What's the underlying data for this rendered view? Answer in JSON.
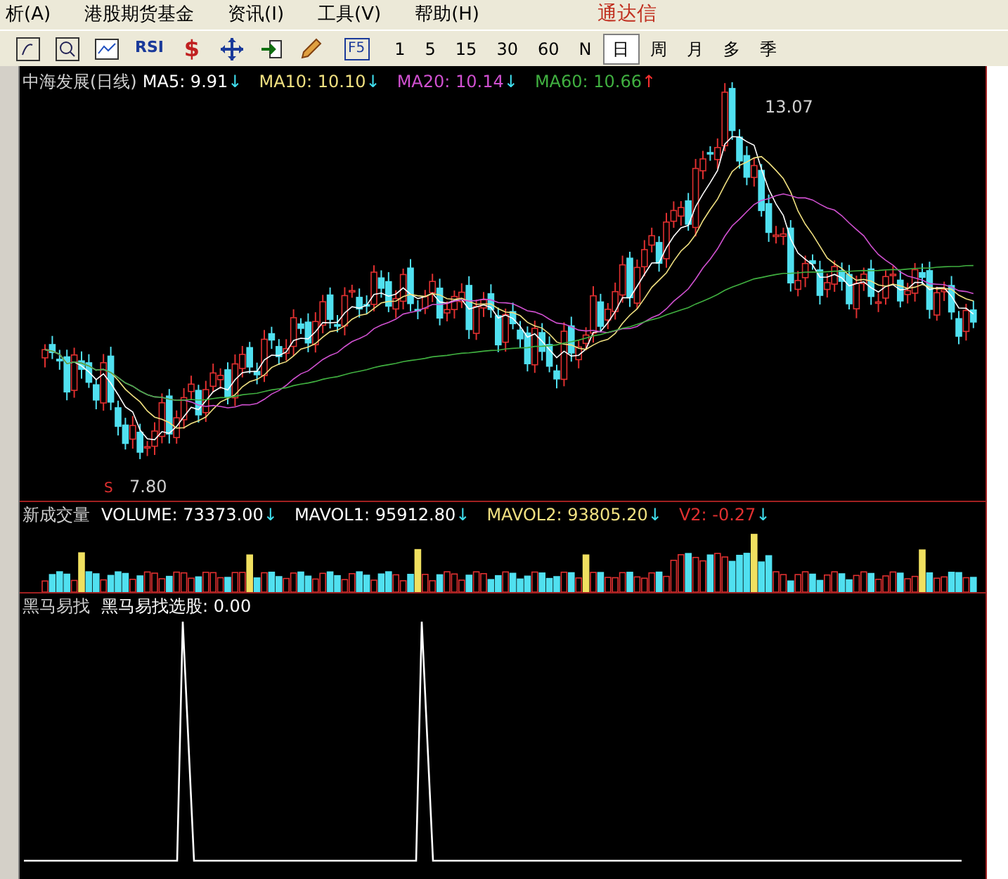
{
  "menu": [
    {
      "label": "析(A)"
    },
    {
      "label": "港股期货基金"
    },
    {
      "label": "资讯(I)"
    },
    {
      "label": "工具(V)"
    },
    {
      "label": "帮助(H)"
    }
  ],
  "brand": "通达信",
  "toolbar": {
    "rsi": "RSI",
    "dollar": "$",
    "f5": "F5",
    "periods": [
      {
        "label": "1",
        "selected": false
      },
      {
        "label": "5",
        "selected": false
      },
      {
        "label": "15",
        "selected": false
      },
      {
        "label": "30",
        "selected": false
      },
      {
        "label": "60",
        "selected": false
      },
      {
        "label": "N",
        "selected": false
      },
      {
        "label": "日",
        "selected": true
      },
      {
        "label": "周",
        "selected": false
      },
      {
        "label": "月",
        "selected": false
      },
      {
        "label": "多",
        "selected": false
      },
      {
        "label": "季",
        "selected": false
      }
    ]
  },
  "main_panel": {
    "title": "中海发展(日线)",
    "legend": [
      {
        "label": "MA5: 9.91",
        "color": "#ffffff",
        "rising": false,
        "arrow": "↓"
      },
      {
        "label": "MA10: 10.10",
        "color": "#f0e080",
        "rising": false,
        "arrow": "↓"
      },
      {
        "label": "MA20: 10.14",
        "color": "#d050d0",
        "rising": false,
        "arrow": "↓"
      },
      {
        "label": "MA60: 10.66",
        "color": "#40b040",
        "rising": true,
        "arrow": "↑"
      }
    ],
    "high_label": "13.07",
    "low_label": "7.80",
    "signal_mark": "S"
  },
  "volume_panel": {
    "title": "新成交量",
    "legend": [
      {
        "label": "VOLUME: 73373.00",
        "color": "#ffffff",
        "rising": false,
        "arrow": "↓"
      },
      {
        "label": "MAVOL1: 95912.80",
        "color": "#ffffff",
        "rising": false,
        "arrow": "↓"
      },
      {
        "label": "MAVOL2: 93805.20",
        "color": "#f0e080",
        "rising": false,
        "arrow": "↓"
      },
      {
        "label": "V2: -0.27",
        "color": "#e03030",
        "rising": false,
        "arrow": "↓"
      }
    ]
  },
  "indicator_panel": {
    "title": "黑马易找",
    "legend": [
      {
        "label": "黑马易找选股: 0.00",
        "color": "#ffffff"
      }
    ]
  }
}
